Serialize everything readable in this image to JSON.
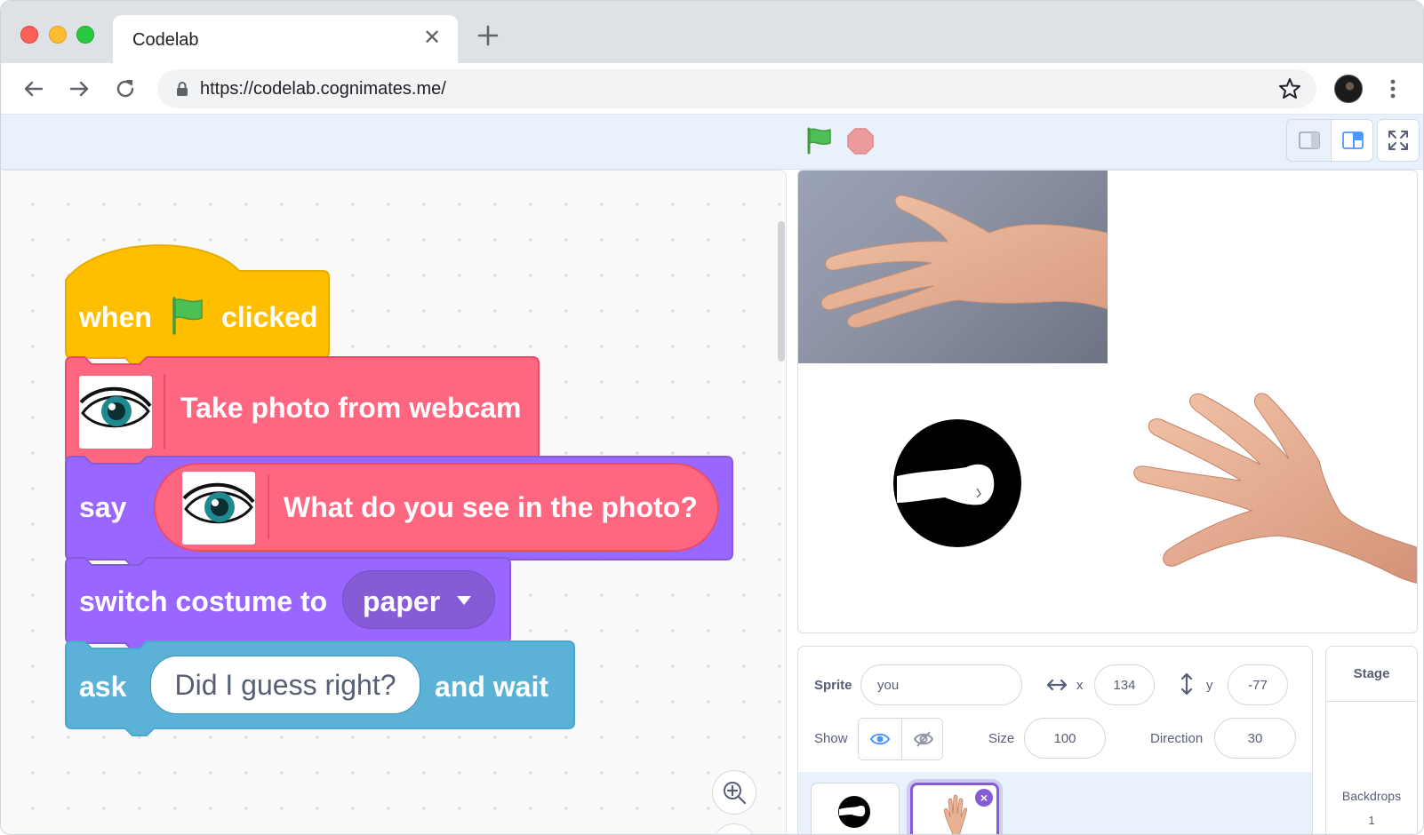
{
  "browser": {
    "tab_title": "Codelab",
    "url": "https://codelab.cognimates.me/"
  },
  "blocks": {
    "hat": {
      "when": "when",
      "clicked": "clicked",
      "color": "#ffbf00"
    },
    "photo": {
      "label": "Take photo from webcam",
      "color": "#ff6680"
    },
    "say": {
      "label": "say",
      "reporter_label": "What do you see in the photo?",
      "color": "#9966ff"
    },
    "costume": {
      "label": "switch costume to",
      "value": "paper",
      "color": "#9966ff"
    },
    "ask": {
      "label": "ask",
      "value": "Did I guess right?",
      "suffix": "and wait",
      "color": "#5cb1d6"
    }
  },
  "sprite_info": {
    "sprite_label": "Sprite",
    "sprite_name": "you",
    "x_label": "x",
    "x_value": "134",
    "y_label": "y",
    "y_value": "-77",
    "show_label": "Show",
    "size_label": "Size",
    "size_value": "100",
    "direction_label": "Direction",
    "direction_value": "30"
  },
  "stage_pane": {
    "title": "Stage",
    "backdrops_label": "Backdrops",
    "backdrops_count": "1"
  },
  "colors": {
    "accent": "#855cd6",
    "header_bg": "#e9f1fc",
    "flag_green": "#4cbf56",
    "stop_red": "#ec9c9c"
  },
  "icons": [
    "back-icon",
    "forward-icon",
    "reload-icon",
    "lock-icon",
    "star-icon",
    "kebab-icon",
    "green-flag-icon",
    "stop-icon",
    "small-stage-icon",
    "normal-stage-icon",
    "fullscreen-icon",
    "eye-icon",
    "eye-off-icon",
    "zoom-in-icon",
    "dropdown-caret-icon",
    "delete-icon",
    "x-arrow-icon",
    "y-arrow-icon"
  ]
}
